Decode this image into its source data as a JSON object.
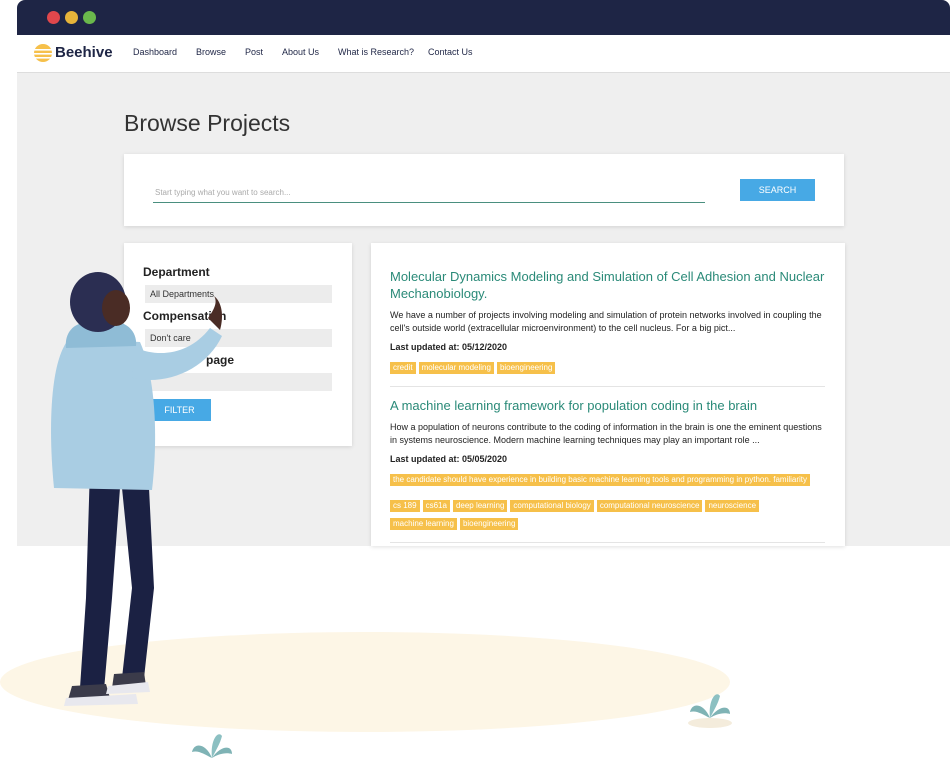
{
  "app": {
    "brand": "Beehive",
    "nav": [
      "Dashboard",
      "Browse",
      "Post",
      "About Us",
      "What is Research?",
      "Contact Us"
    ]
  },
  "page_title": "Browse Projects",
  "search": {
    "placeholder": "Start typing what you want to search...",
    "button_label": "SEARCH"
  },
  "filters": {
    "department_label": "Department",
    "department_value": "All Departments",
    "compensation_label": "Compensation",
    "compensation_value": "Don't care",
    "page_label": "page",
    "filter_button": "FILTER"
  },
  "results": [
    {
      "title": "Molecular Dynamics Modeling and Simulation of Cell Adhesion and Nuclear Mechanobiology.",
      "description": "We have a number of projects involving modeling and simulation of protein networks involved in coupling the cell's outside world (extracellular microenvironment) to the cell nucleus. For a big pict...",
      "updated": "Last updated at: 05/12/2020",
      "tags": [
        "credit",
        "molecular modeling",
        "bioengineering"
      ]
    },
    {
      "title": "A machine learning framework for population coding in the brain",
      "description": "How a population of neurons contribute to the coding of information in the brain is one the eminent questions in systems neuroscience. Modern machine learning techniques may play an important role ...",
      "updated": "Last updated at: 05/05/2020",
      "long_tag": "the candidate should have experience in building basic machine learning tools and programming in python. familiarity",
      "tags": [
        "cs 189",
        "cs61a",
        "deep learning",
        "computational biology",
        "computational neuroscience",
        "neuroscience",
        "machine learning",
        "bioengineering"
      ]
    }
  ],
  "colors": {
    "titlebar": "#1e2545",
    "accent": "#47a9e5",
    "link": "#2a8a78",
    "tag": "#f6c04a"
  }
}
